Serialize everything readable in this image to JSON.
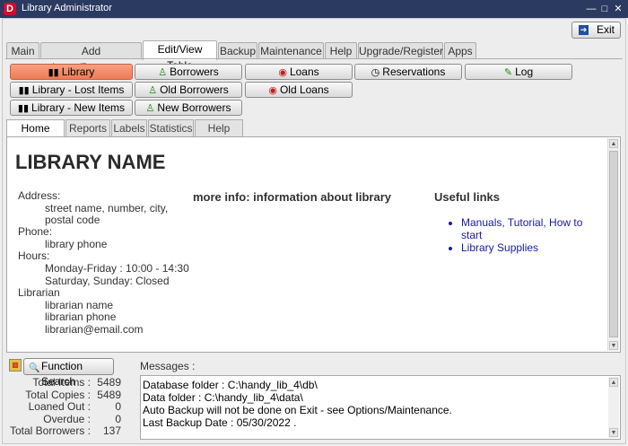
{
  "window": {
    "title": "Library Administrator",
    "app_icon": "D"
  },
  "exit_label": "Exit",
  "main_tabs": [
    "Main",
    "Add Items/Borrowers",
    "Edit/View Table",
    "Backup",
    "Maintenance",
    "Help",
    "Upgrade/Register",
    "Apps"
  ],
  "section_buttons": {
    "library": "Library",
    "borrowers": "Borrowers",
    "loans": "Loans",
    "reservations": "Reservations",
    "log": "Log",
    "lost_items": "Library - Lost Items",
    "old_borrowers": "Old Borrowers",
    "old_loans": "Old Loans",
    "new_items": "Library - New Items",
    "new_borrowers": "New Borrowers"
  },
  "sub_tabs": [
    "Home Page",
    "Reports",
    "Labels",
    "Statistics",
    "Help Links"
  ],
  "home": {
    "library_name": "LIBRARY NAME",
    "address_label": "Address:",
    "address_line1": "street name, number, city,",
    "address_line2": "postal code",
    "phone_label": "Phone:",
    "phone_value": "library phone",
    "hours_label": "Hours:",
    "hours_line1": "Monday-Friday : 10:00 - 14:30",
    "hours_line2": "Saturday, Sunday: Closed",
    "librarian_label": "Librarian",
    "librarian_name": "librarian name",
    "librarian_phone": "librarian phone",
    "librarian_email": "librarian@email.com",
    "more_info": "more info: information about library",
    "useful_links_title": "Useful links",
    "link1": "Manuals, Tutorial, How to start",
    "link2": "Library Supplies"
  },
  "function_search_label": "Function Search",
  "messages_label": "Messages :",
  "stats": {
    "total_items_label": "Total Items :",
    "total_items": "5489",
    "total_copies_label": "Total Copies :",
    "total_copies": "5489",
    "loaned_out_label": "Loaned Out :",
    "loaned_out": "0",
    "overdue_label": "Overdue :",
    "overdue": "0",
    "total_borrowers_label": "Total Borrowers :",
    "total_borrowers": "137"
  },
  "messages": [
    "Database folder : C:\\handy_lib_4\\db\\",
    "Data folder : C:\\handy_lib_4\\data\\",
    "Auto Backup will not be done on Exit - see Options/Maintenance.",
    "Last Backup Date : 05/30/2022 ."
  ],
  "colors": {
    "titlebar": "#2b3a61",
    "active_button": "#ee7a55",
    "link": "#1a1aa6"
  }
}
